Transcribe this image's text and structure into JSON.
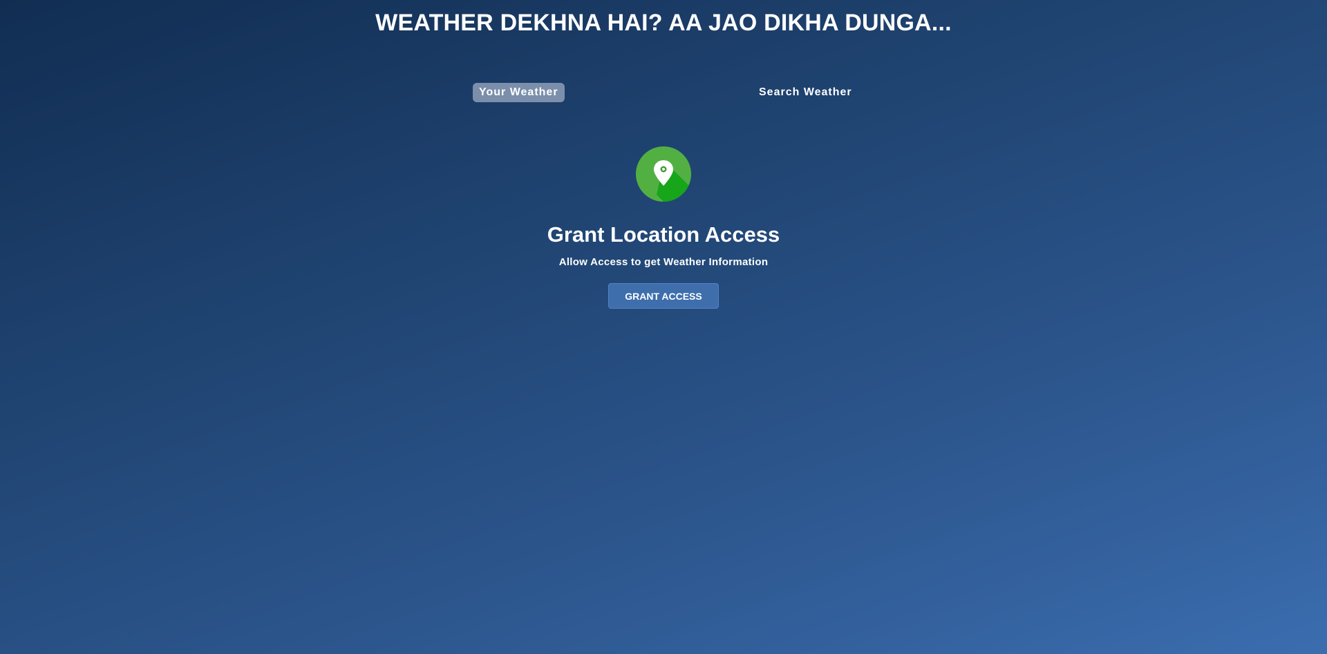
{
  "header": {
    "title": "WEATHER DEKHNA HAI? AA JAO DIKHA DUNGA..."
  },
  "tabs": [
    {
      "label": "Your Weather",
      "active": true
    },
    {
      "label": "Search Weather",
      "active": false
    }
  ],
  "grant": {
    "icon": "location-pin-icon",
    "heading": "Grant Location Access",
    "subtext": "Allow Access to get Weather Information",
    "button_label": "GRANT ACCESS"
  },
  "colors": {
    "icon_circle": "#52b043",
    "icon_shadow": "#17a51a",
    "button_bg": "#3e6eac"
  }
}
